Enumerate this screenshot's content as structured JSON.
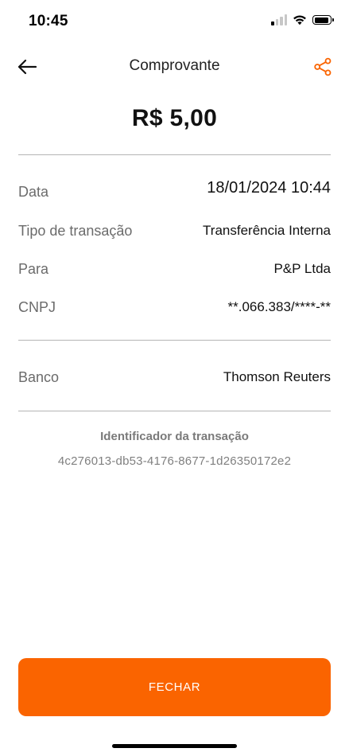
{
  "status_bar": {
    "time": "10:45",
    "signal_icon": "cellular-signal-icon",
    "signal_bars_active": 1,
    "wifi_icon": "wifi-icon",
    "battery_icon": "battery-icon"
  },
  "header": {
    "back_icon": "arrow-left-icon",
    "title": "Comprovante",
    "share_icon": "share-icon"
  },
  "amount": "R$ 5,00",
  "details": [
    {
      "label": "Data",
      "value": "18/01/2024 10:44"
    },
    {
      "label": "Tipo de transação",
      "value": "Transferência Interna"
    },
    {
      "label": "Para",
      "value": "P&P Ltda"
    },
    {
      "label": "CNPJ",
      "value": "**.066.383/****-**"
    }
  ],
  "bank": {
    "label": "Banco",
    "value": "Thomson Reuters"
  },
  "transaction_id": {
    "title": "Identificador da transação",
    "value": "4c276013-db53-4176-8677-1d26350172e2"
  },
  "close_button": {
    "label": "FECHAR"
  },
  "colors": {
    "accent": "#fa6400",
    "divider": "#b5b5b5",
    "label_text": "#6b6b6b",
    "value_text": "#111111"
  }
}
